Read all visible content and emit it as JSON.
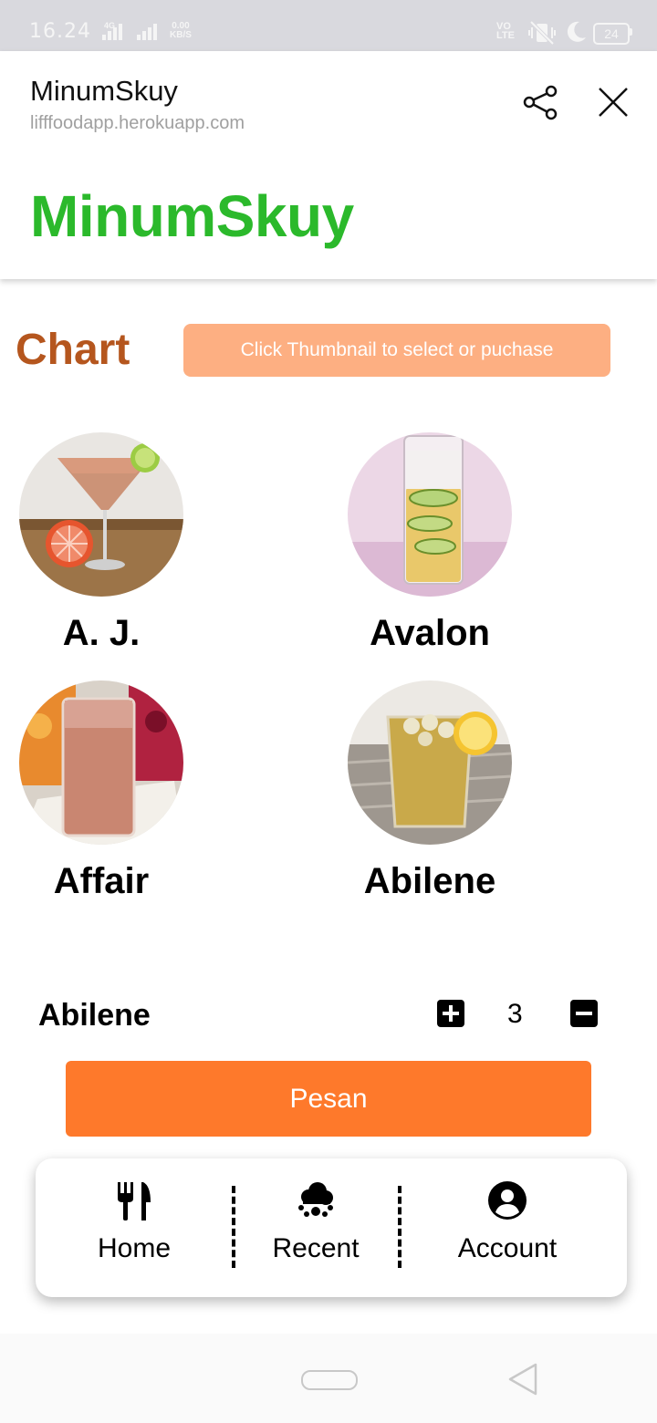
{
  "status_bar": {
    "time": "16.24",
    "network": "4G",
    "speed_value": "0.00",
    "speed_unit": "KB/S",
    "volte_line1": "VO",
    "volte_line2": "LTE",
    "battery": "24"
  },
  "liff_header": {
    "title": "MinumSkuy",
    "url": "lifffoodapp.herokuapp.com"
  },
  "brand": "MinumSkuy",
  "chart": {
    "heading": "Chart",
    "hint": "Click Thumbnail to select or puchase"
  },
  "products": [
    {
      "name": "A. J.",
      "image": "grapefruit-cocktail-martini-glass"
    },
    {
      "name": "Avalon",
      "image": "cucumber-highball-drink"
    },
    {
      "name": "Affair",
      "image": "pink-juice-highball"
    },
    {
      "name": "Abilene",
      "image": "iced-tea-lemon-glass"
    }
  ],
  "order": {
    "selected_name": "Abilene",
    "quantity": "3",
    "button_label": "Pesan"
  },
  "bottom_nav": {
    "items": [
      {
        "label": "Home",
        "icon": "utensils-icon"
      },
      {
        "label": "Recent",
        "icon": "cloud-icon"
      },
      {
        "label": "Account",
        "icon": "user-circle-icon"
      }
    ]
  },
  "colors": {
    "brand_green": "#2bb92b",
    "heading_brown": "#b5561e",
    "hint_peach": "#fdaf82",
    "order_orange": "#fe792b"
  }
}
